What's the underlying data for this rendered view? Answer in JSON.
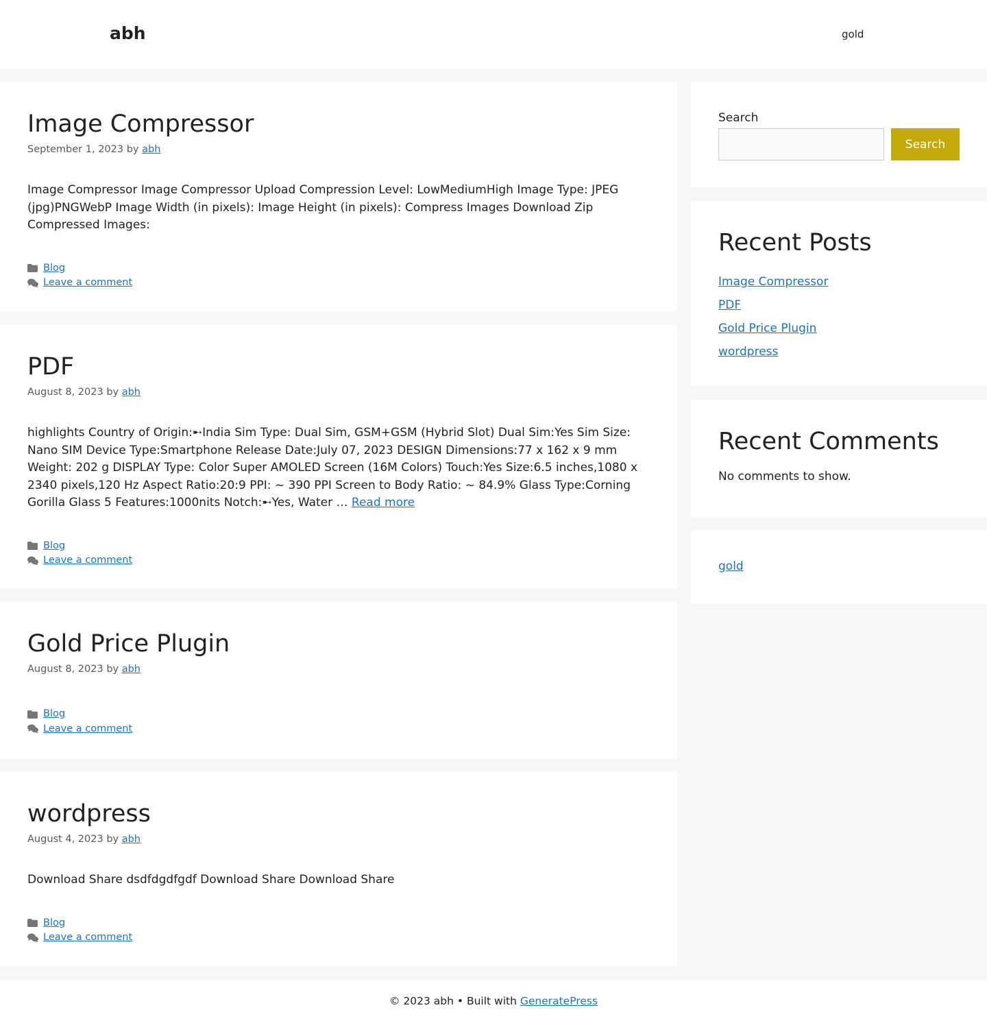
{
  "header": {
    "site_title": "abh",
    "nav_item": "gold"
  },
  "posts": [
    {
      "title": "Image Compressor",
      "date": "September 1, 2023",
      "by": "by",
      "author": "abh",
      "excerpt": "Image Compressor Image Compressor Upload Compression Level: LowMediumHigh Image Type: JPEG (jpg)PNGWebP Image Width (in pixels): Image Height (in pixels): Compress Images Download Zip Compressed Images:",
      "category": "Blog",
      "comment_link": "Leave a comment"
    },
    {
      "title": "PDF",
      "date": "August 8, 2023",
      "by": "by",
      "author": "abh",
      "excerpt": "highlights Country of Origin:➸India Sim Type: Dual Sim, GSM+GSM (Hybrid Slot) Dual Sim:Yes Sim Size: Nano SIM Device Type:Smartphone Release Date:July 07, 2023 DESIGN Dimensions:77 x 162 x 9 mm Weight: 202 g DISPLAY Type: Color Super AMOLED Screen (16M Colors) Touch:Yes Size:6.5 inches,1080 x 2340 pixels,120 Hz Aspect Ratio:20:9 PPI: ~ 390 PPI Screen to Body Ratio: ~ 84.9% Glass Type:Corning Gorilla Glass 5 Features:1000nits Notch:➸Yes, Water …",
      "read_more": "Read more",
      "category": "Blog",
      "comment_link": "Leave a comment"
    },
    {
      "title": "Gold Price Plugin",
      "date": "August 8, 2023",
      "by": "by",
      "author": "abh",
      "category": "Blog",
      "comment_link": "Leave a comment"
    },
    {
      "title": "wordpress",
      "date": "August 4, 2023",
      "by": "by",
      "author": "abh",
      "excerpt": "Download Share dsdfdgdfgdf Download Share Download Share",
      "category": "Blog",
      "comment_link": "Leave a comment"
    }
  ],
  "sidebar": {
    "search": {
      "label": "Search",
      "button_label": "Search",
      "input_value": ""
    },
    "recent_posts": {
      "title": "Recent Posts",
      "items": [
        "Image Compressor",
        "PDF",
        "Gold Price Plugin",
        "wordpress"
      ]
    },
    "recent_comments": {
      "title": "Recent Comments",
      "empty_text": "No comments to show."
    },
    "nav_widget": {
      "link": "gold"
    }
  },
  "footer": {
    "copyright": "© 2023 abh • Built with ",
    "link": "GeneratePress"
  },
  "icons": {
    "category": "folder-icon",
    "comments": "comments-icon"
  },
  "colors": {
    "link": "#1e73be",
    "button": "#c2aa0a",
    "background": "#f7f8f9"
  }
}
